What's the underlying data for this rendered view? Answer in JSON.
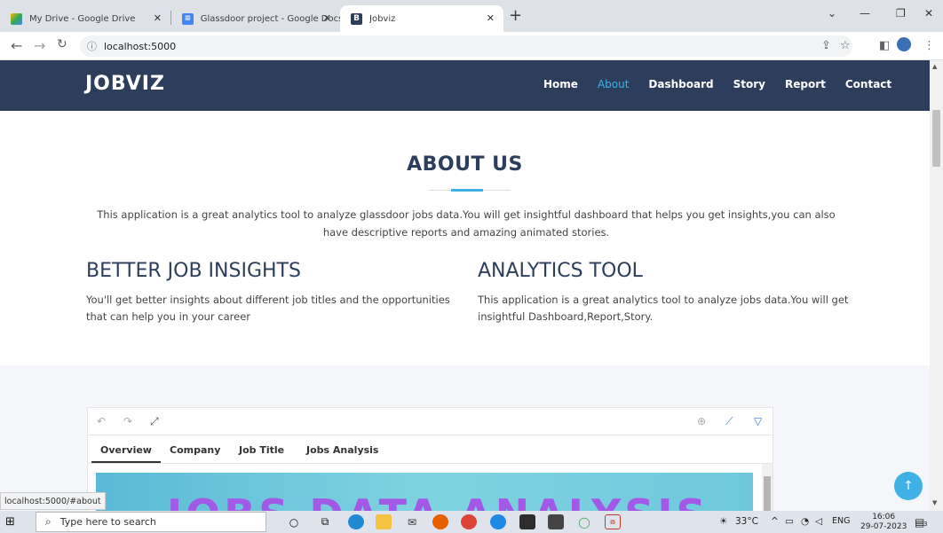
{
  "browser": {
    "tabs": [
      {
        "label": "My Drive - Google Drive"
      },
      {
        "label": "Glassdoor project - Google Docs"
      },
      {
        "label": "Jobviz"
      }
    ],
    "new_tab": "+",
    "url": "localhost:5000"
  },
  "site": {
    "brand": "JOBVIZ",
    "nav": [
      "Home",
      "About",
      "Dashboard",
      "Story",
      "Report",
      "Contact"
    ],
    "active_nav": "About"
  },
  "about": {
    "title": "ABOUT US",
    "intro": "This application is a great analytics tool to analyze glassdoor jobs data.You will get insightful dashboard that helps you get insights,you can also have descriptive reports and amazing animated stories.",
    "columns": [
      {
        "title": "BETTER JOB INSIGHTS",
        "text": "You'll get better insights about different job titles and the opportunities that can help you in your career"
      },
      {
        "title": "ANALYTICS TOOL",
        "text": "This application is a great analytics tool to analyze jobs data.You will get insightful Dashboard,Report,Story."
      }
    ]
  },
  "embed": {
    "tabs": [
      "Overview",
      "Company",
      "Job Title",
      "Jobs Analysis"
    ],
    "active_tab": "Overview",
    "dashboard_title": "JOBS DATA ANALYSIS"
  },
  "status_url": "localhost:5000/#about",
  "taskbar": {
    "search_placeholder": "Type here to search",
    "weather": "33°C",
    "lang": "ENG",
    "time": "16:06",
    "date": "29-07-2023",
    "notifications": "3"
  }
}
